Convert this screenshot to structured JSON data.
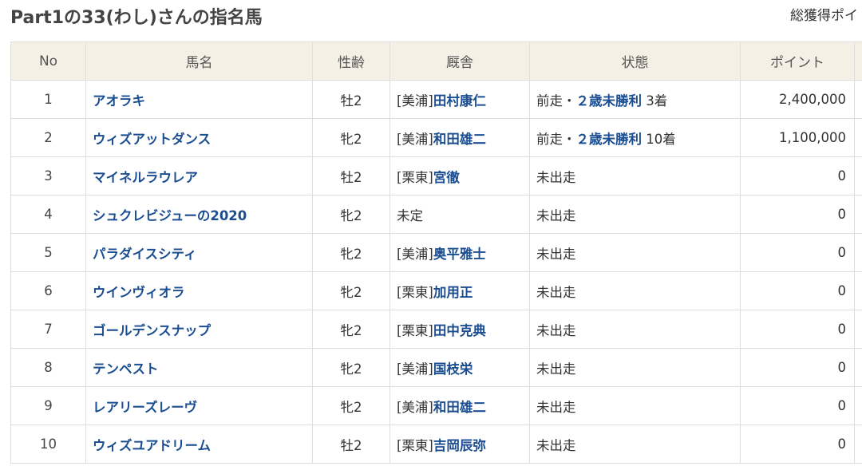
{
  "page": {
    "title": "Part1の33(わし)さんの指名馬",
    "total_label": "総獲得ポイ"
  },
  "table": {
    "headers": [
      "No",
      "馬名",
      "性齢",
      "厩舎",
      "状態",
      "ポイント"
    ],
    "rows": [
      {
        "no": "1",
        "name": "アオラキ",
        "sex_age": "牡2",
        "stable_region": "[美浦]",
        "stable_trainer": "田村康仁",
        "status_prefix": "前走・",
        "status_race": "２歳未勝利",
        "status_result": " 3着",
        "points": "2,400,000"
      },
      {
        "no": "2",
        "name": "ウィズアットダンス",
        "sex_age": "牝2",
        "stable_region": "[美浦]",
        "stable_trainer": "和田雄二",
        "status_prefix": "前走・",
        "status_race": "２歳未勝利",
        "status_result": " 10着",
        "points": "1,100,000"
      },
      {
        "no": "3",
        "name": "マイネルラウレア",
        "sex_age": "牡2",
        "stable_region": "[栗東]",
        "stable_trainer": "宮徹",
        "status_prefix": "未出走",
        "status_race": "",
        "status_result": "",
        "points": "0"
      },
      {
        "no": "4",
        "name": "シュクレビジューの2020",
        "sex_age": "牝2",
        "stable_region": "未定",
        "stable_trainer": "",
        "status_prefix": "未出走",
        "status_race": "",
        "status_result": "",
        "points": "0"
      },
      {
        "no": "5",
        "name": "パラダイスシティ",
        "sex_age": "牝2",
        "stable_region": "[美浦]",
        "stable_trainer": "奥平雅士",
        "status_prefix": "未出走",
        "status_race": "",
        "status_result": "",
        "points": "0"
      },
      {
        "no": "6",
        "name": "ウインヴィオラ",
        "sex_age": "牝2",
        "stable_region": "[栗東]",
        "stable_trainer": "加用正",
        "status_prefix": "未出走",
        "status_race": "",
        "status_result": "",
        "points": "0"
      },
      {
        "no": "7",
        "name": "ゴールデンスナップ",
        "sex_age": "牝2",
        "stable_region": "[栗東]",
        "stable_trainer": "田中克典",
        "status_prefix": "未出走",
        "status_race": "",
        "status_result": "",
        "points": "0"
      },
      {
        "no": "8",
        "name": "テンペスト",
        "sex_age": "牝2",
        "stable_region": "[美浦]",
        "stable_trainer": "国枝栄",
        "status_prefix": "未出走",
        "status_race": "",
        "status_result": "",
        "points": "0"
      },
      {
        "no": "9",
        "name": "レアリーズレーヴ",
        "sex_age": "牝2",
        "stable_region": "[美浦]",
        "stable_trainer": "和田雄二",
        "status_prefix": "未出走",
        "status_race": "",
        "status_result": "",
        "points": "0"
      },
      {
        "no": "10",
        "name": "ウィズユアドリーム",
        "sex_age": "牡2",
        "stable_region": "[栗東]",
        "stable_trainer": "吉岡辰弥",
        "status_prefix": "未出走",
        "status_race": "",
        "status_result": "",
        "points": "0"
      }
    ]
  },
  "colors": {
    "header_bg": "#f5f0e6",
    "link": "#1b4d91",
    "border": "#dedede"
  }
}
